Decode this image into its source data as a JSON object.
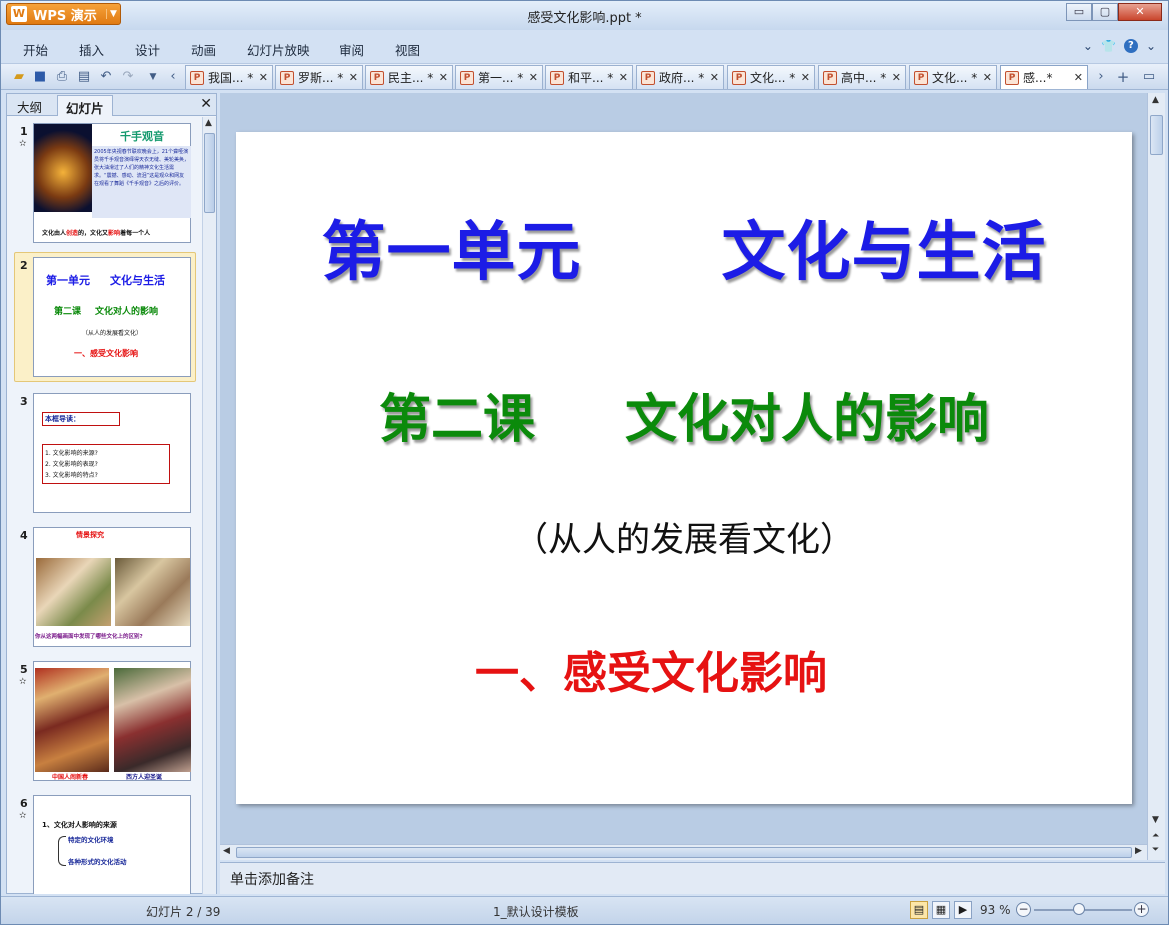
{
  "window": {
    "app_button": "WPS 演示",
    "title": "感受文化影响.ppt *",
    "controls": {
      "minimize": "▭",
      "maximize": "▢",
      "close": "✕"
    }
  },
  "menu": {
    "items": [
      "开始",
      "插入",
      "设计",
      "动画",
      "幻灯片放映",
      "审阅",
      "视图"
    ],
    "right_icons": [
      "chevron-down-icon",
      "shirt-icon",
      "help-icon",
      "chevron-down-icon"
    ]
  },
  "doc_tabs": [
    {
      "label": "我国... *",
      "active": false
    },
    {
      "label": "罗斯... *",
      "active": false
    },
    {
      "label": "民主... *",
      "active": false
    },
    {
      "label": "第一... *",
      "active": false
    },
    {
      "label": "和平... *",
      "active": false
    },
    {
      "label": "政府... *",
      "active": false
    },
    {
      "label": "文化... *",
      "active": false
    },
    {
      "label": "高中... *",
      "active": false
    },
    {
      "label": "文化... *",
      "active": false
    },
    {
      "label": "感...*",
      "active": true
    }
  ],
  "left_pane": {
    "tabs": [
      "大纲",
      "幻灯片"
    ],
    "active_tab": "幻灯片",
    "slides": [
      {
        "num": "1",
        "title": "千手观音",
        "body": "2005年央视春节联欢晚会上，21个聋哑演员将千手观音演绎得天衣无缝、美轮美奂，张大油滑过了人们的精神文化生活需求。“震撼、感动、流泪”这是观众和网友在观看了舞蹈《千手观音》之后的评价。",
        "caption_pre": "文化由人",
        "caption_red1": "创造",
        "caption_mid": "的，文化又",
        "caption_red2": "影响",
        "caption_post": "着每一个人"
      },
      {
        "num": "2",
        "line1": "第一单元",
        "line1b": "文化与生活",
        "line2": "第二课",
        "line2b": "文化对人的影响",
        "line3": "（从人的发展看文化）",
        "line4": "一、感受文化影响"
      },
      {
        "num": "3",
        "head": "本框导读：",
        "items": [
          "1. 文化影响的来源?",
          "2. 文化影响的表现?",
          "3. 文化影响的特点?"
        ]
      },
      {
        "num": "4",
        "head": "情景探究",
        "caption": "你从这两幅画面中发现了哪些文化上的区别?"
      },
      {
        "num": "5",
        "left_caption": "中国人闹新春",
        "right_caption": "西方人迎圣诞"
      },
      {
        "num": "6",
        "head": "1、文化对人影响的来源",
        "items": [
          "特定的文化环境",
          "各种形式的文化活动"
        ]
      }
    ]
  },
  "slide": {
    "line1a": "第一单元",
    "line1b": "文化与生活",
    "line2a": "第二课",
    "line2b": "文化对人的影响",
    "line3": "（从人的发展看文化）",
    "line4": "一、感受文化影响"
  },
  "notes_placeholder": "单击添加备注",
  "status": {
    "slide_count": "幻灯片 2 / 39",
    "template": "1_默认设计模板",
    "zoom": "93 %"
  },
  "colors": {
    "title_blue": "#1c1ce6",
    "subtitle_green": "#0b8a0b",
    "accent_red": "#e61212",
    "app_orange": "#e88a1e"
  }
}
